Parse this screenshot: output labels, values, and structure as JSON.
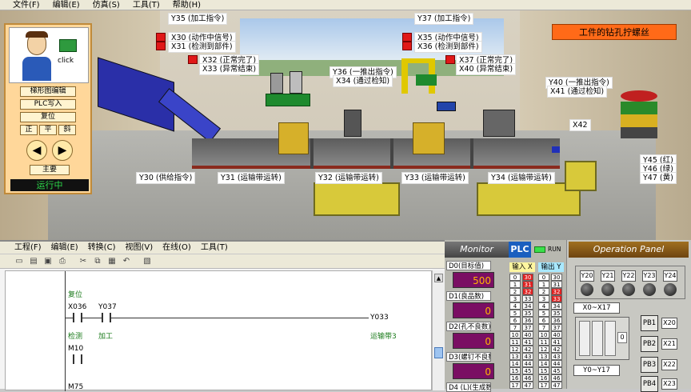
{
  "menu": [
    "文件(F)",
    "编辑(E)",
    "仿真(S)",
    "工具(T)",
    "帮助(H)"
  ],
  "scene": {
    "banner": "工件的钻孔拧螺丝",
    "labels": {
      "y35": "Y35 (加工指令)",
      "x30": "X30 (动作中信号)",
      "x31": "X31 (检测到部件)",
      "x32": "X32 (正常完了)",
      "x33": "X33 (异常结束)",
      "y37": "Y37 (加工指令)",
      "x35": "X35 (动作中信号)",
      "x36": "X36 (检测到部件)",
      "x37": "X37 (正常完了)",
      "x40a": "X40 (异常结束)",
      "y36": "Y36 (一推出指令)",
      "x34": "X34 (通过检知)",
      "y40": "Y40 (一推出指令)",
      "x41": "X41 (通过检知)",
      "x42": "X42",
      "y45": "Y45 (红)",
      "y46": "Y46 (绿)",
      "y47": "Y47 (黄)",
      "y30": "Y30 (供给指令)",
      "y31": "Y31 (运输带运转)",
      "y32": "Y32 (运输带运转)",
      "y33": "Y33 (运输带运转)",
      "y34": "Y34 (运输带运转)"
    }
  },
  "control_panel": {
    "avatar_caption": "click",
    "buttons": {
      "ladder_edit": "梯形图编辑",
      "plc_write": "PLC写入",
      "reset": "复位",
      "front": "正",
      "flat": "平",
      "tilt": "斜",
      "main": "主要"
    },
    "status": "运行中"
  },
  "editor": {
    "menu": [
      "工程(F)",
      "编辑(E)",
      "转换(C)",
      "视图(V)",
      "在线(O)",
      "工具(T)"
    ],
    "ladder": {
      "reset_label": "复位",
      "x036": "X036",
      "y037": "Y037",
      "y033": "Y033",
      "detect": "检测",
      "process": "加工",
      "conveyor3": "运输带3",
      "m10": "M10",
      "m75": "M75"
    }
  },
  "monitor": {
    "title": "Monitor",
    "registers": [
      {
        "label": "D0(目标值)",
        "value": "500"
      },
      {
        "label": "D1(良品数)",
        "value": "0"
      },
      {
        "label": "D2(孔不良数)",
        "value": "0"
      },
      {
        "label": "D3(螺钉不良数)",
        "value": "0"
      },
      {
        "label": "D4 (L)(生成数)",
        "value": ""
      }
    ]
  },
  "plc": {
    "tag": "PLC",
    "run": "RUN",
    "input_head": "输入 X",
    "output_head": "输出 Y",
    "inputs": [
      "0",
      "1",
      "2",
      "3",
      "4",
      "5",
      "6",
      "7",
      "10",
      "11",
      "12",
      "13",
      "14",
      "15",
      "16",
      "17"
    ],
    "inputs2": [
      "30",
      "31",
      "32",
      "33",
      "34",
      "35",
      "36",
      "37",
      "40",
      "41",
      "42",
      "43",
      "44",
      "45",
      "46",
      "47"
    ],
    "outputs": [
      "0",
      "1",
      "2",
      "3",
      "4",
      "5",
      "6",
      "7",
      "10",
      "11",
      "12",
      "13",
      "14",
      "15",
      "16",
      "17"
    ],
    "outputs2": [
      "30",
      "31",
      "32",
      "33",
      "34",
      "35",
      "36",
      "37",
      "40",
      "41",
      "42",
      "43",
      "44",
      "45",
      "46",
      "47"
    ]
  },
  "operation_panel": {
    "title": "Operation Panel",
    "lamps": [
      "Y20",
      "Y21",
      "Y22",
      "Y23",
      "Y24"
    ],
    "range_x": "X0~X17",
    "range_y": "Y0~Y17",
    "pushbuttons": [
      {
        "label": "PB1",
        "x": "X20"
      },
      {
        "label": "PB2",
        "x": "X21"
      },
      {
        "label": "PB3",
        "x": "X22"
      },
      {
        "label": "PB4",
        "x": "X23"
      }
    ],
    "switch_value": "0"
  }
}
